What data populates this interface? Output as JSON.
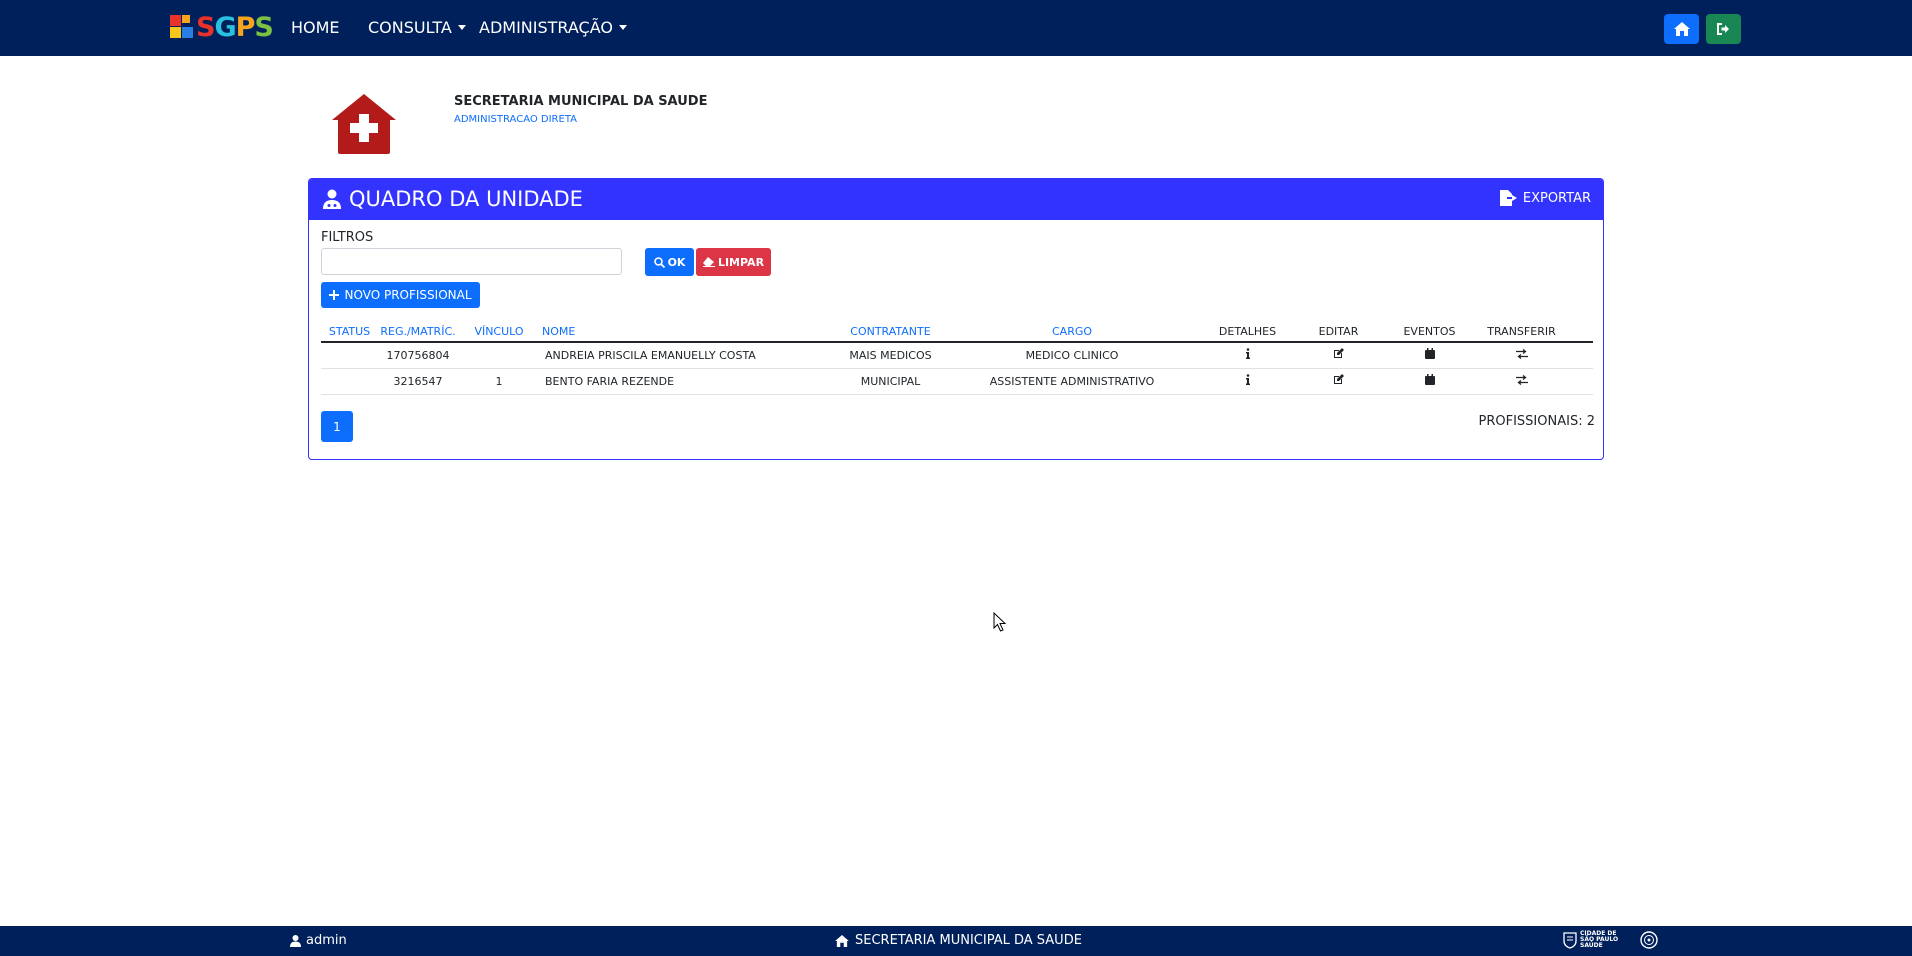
{
  "app": {
    "logo_text": "SGPS",
    "colors": {
      "navbar": "#00205b",
      "card": "#3333ff",
      "primary": "#0d6efd",
      "danger": "#dc3545",
      "success": "#198754",
      "org_icon": "#b31b1b"
    }
  },
  "nav": {
    "home": "HOME",
    "consulta": "CONSULTA",
    "administracao": "ADMINISTRAÇÃO",
    "home_button_icon": "home-icon",
    "logout_button_icon": "logout-icon"
  },
  "org": {
    "name": "SECRETARIA MUNICIPAL DA SAUDE",
    "sub": "ADMINISTRACAO DIRETA",
    "icon": "health-house-icon"
  },
  "card": {
    "title": "QUADRO DA UNIDADE",
    "export": "EXPORTAR",
    "filter_label": "FILTROS",
    "filter_value": "",
    "ok_label": "OK",
    "clear_label": "LIMPAR",
    "new_label": "NOVO PROFISSIONAL"
  },
  "table": {
    "headers": {
      "status": "STATUS",
      "reg": "REG./MATRÍC.",
      "vinculo": "VÍNCULO",
      "nome": "NOME",
      "contratante": "CONTRATANTE",
      "cargo": "CARGO",
      "detalhes": "DETALHES",
      "editar": "EDITAR",
      "eventos": "EVENTOS",
      "transferir": "TRANSFERIR"
    },
    "rows": [
      {
        "status": "",
        "reg": "170756804",
        "vinculo": "",
        "nome": "ANDREIA PRISCILA EMANUELLY COSTA",
        "contratante": "MAIS MEDICOS",
        "cargo": "MEDICO CLINICO"
      },
      {
        "status": "",
        "reg": "3216547",
        "vinculo": "1",
        "nome": "BENTO FARIA REZENDE",
        "contratante": "MUNICIPAL",
        "cargo": "ASSISTENTE ADMINISTRATIVO"
      }
    ]
  },
  "pagination": {
    "current": "1"
  },
  "summary": {
    "count": "PROFISSIONAIS: 2"
  },
  "footer": {
    "user": "admin",
    "org": "SECRETARIA MUNICIPAL DA SAUDE",
    "city_line1": "CIDADE DE",
    "city_line2": "SÃO PAULO",
    "city_line3": "SAÚDE"
  }
}
